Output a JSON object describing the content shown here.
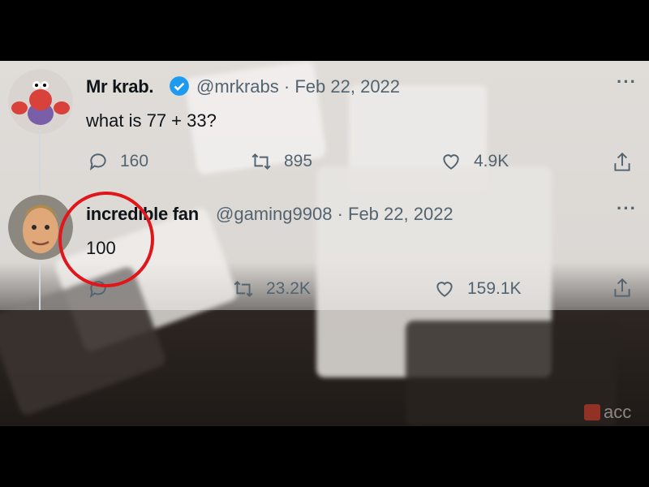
{
  "tweets": [
    {
      "name": "Mr krab.",
      "handle": "@mrkrabs",
      "date": "· Feb 22, 2022",
      "text": "what is 77 + 33?",
      "verified": true,
      "reply_count": "160",
      "retweet_count": "895",
      "like_count": "4.9K",
      "more": "···"
    },
    {
      "name": "incredible fan",
      "handle": "@gaming9908",
      "date": "· Feb 22, 2022",
      "text": "100",
      "verified": false,
      "retweet_count": "23.2K",
      "like_count": "159.1K",
      "more": "···"
    }
  ],
  "watermark": {
    "text": "acc"
  },
  "colors": {
    "accent": "#1d9bf0",
    "annotation": "#e0161b",
    "muted": "#536471",
    "text": "#0f1419"
  },
  "icons": [
    "reply-icon",
    "retweet-icon",
    "like-icon",
    "share-icon",
    "verified-icon",
    "more-icon"
  ]
}
